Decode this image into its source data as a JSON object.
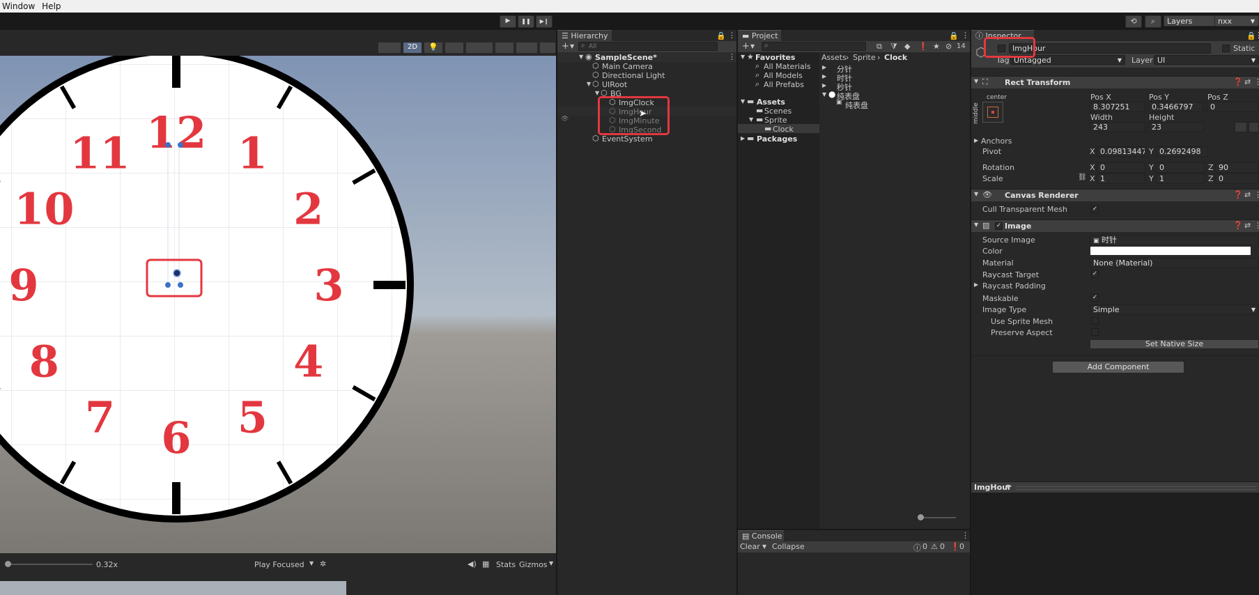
{
  "menu": {
    "items": [
      "Window",
      "Help"
    ]
  },
  "toolbar": {
    "play": "▶",
    "pause": "❚❚",
    "step": "▶❙",
    "history_icon": "⟲",
    "search_icon": "⌕",
    "layers_label": "Layers",
    "layout_label": "nxx"
  },
  "scene": {
    "mode_2d": "2D",
    "zoom_value": "0.32x",
    "play_focused": "Play Focused",
    "stats": "Stats",
    "gizmos": "Gizmos",
    "clock_numbers": [
      "12",
      "1",
      "2",
      "3",
      "4",
      "5",
      "6",
      "7",
      "8",
      "9",
      "10",
      "11"
    ],
    "accent_color": "#e3373f"
  },
  "hierarchy": {
    "tab": "Hierarchy",
    "search_placeholder": "All",
    "items": [
      {
        "label": "SampleScene*"
      },
      {
        "label": "Main Camera"
      },
      {
        "label": "Directional Light"
      },
      {
        "label": "UIRoot"
      },
      {
        "label": "BG"
      },
      {
        "label": "ImgClock"
      },
      {
        "label": "ImgHour"
      },
      {
        "label": "ImgMinute"
      },
      {
        "label": "ImgSecond"
      },
      {
        "label": "EventSystem"
      }
    ]
  },
  "project": {
    "tab": "Project",
    "count_badge": "14",
    "favorites": {
      "label": "Favorites",
      "items": [
        "All Materials",
        "All Models",
        "All Prefabs"
      ]
    },
    "assets": {
      "label": "Assets",
      "items": [
        "Scenes",
        "Sprite",
        "Clock"
      ]
    },
    "packages": "Packages",
    "breadcrumb": [
      "Assets",
      "Sprite",
      "Clock"
    ],
    "files": [
      "分针",
      "时针",
      "秒针",
      "纯表盘",
      "纯表盘"
    ]
  },
  "console": {
    "tab": "Console",
    "clear": "Clear",
    "collapse": "Collapse",
    "counts": [
      "0",
      "0",
      "0"
    ]
  },
  "inspector": {
    "tab": "Inspector",
    "object_name": "ImgHour",
    "static_label": "Static",
    "tag_label": "Tag",
    "tag_value": "Untagged",
    "layer_label": "Layer",
    "layer_value": "UI",
    "rect_transform": {
      "title": "Rect Transform",
      "anchor_h": "center",
      "anchor_v": "middle",
      "posx_label": "Pos X",
      "posy_label": "Pos Y",
      "posz_label": "Pos Z",
      "posx": "8.307251",
      "posy": "0.3466797",
      "posz": "0",
      "width_label": "Width",
      "height_label": "Height",
      "width": "243",
      "height": "23",
      "anchors_label": "Anchors",
      "pivot_label": "Pivot",
      "pivot_x": "0.09813447",
      "pivot_y": "0.2692498",
      "rotation_label": "Rotation",
      "rot_x": "0",
      "rot_y": "0",
      "rot_z": "90",
      "scale_label": "Scale",
      "scale_x": "1",
      "scale_y": "1",
      "scale_z": "0",
      "x": "X",
      "y": "Y",
      "z": "Z"
    },
    "canvas_renderer": {
      "title": "Canvas Renderer",
      "cull_label": "Cull Transparent Mesh"
    },
    "image": {
      "title": "Image",
      "source_label": "Source Image",
      "source_value": "时针",
      "color_label": "Color",
      "material_label": "Material",
      "material_value": "None (Material)",
      "raycast_target": "Raycast Target",
      "raycast_padding": "Raycast Padding",
      "maskable": "Maskable",
      "image_type": "Image Type",
      "image_type_value": "Simple",
      "use_sprite_mesh": "Use Sprite Mesh",
      "preserve_aspect": "Preserve Aspect",
      "set_native_size": "Set Native Size"
    },
    "add_component": "Add Component",
    "preview_label": "ImgHour"
  }
}
